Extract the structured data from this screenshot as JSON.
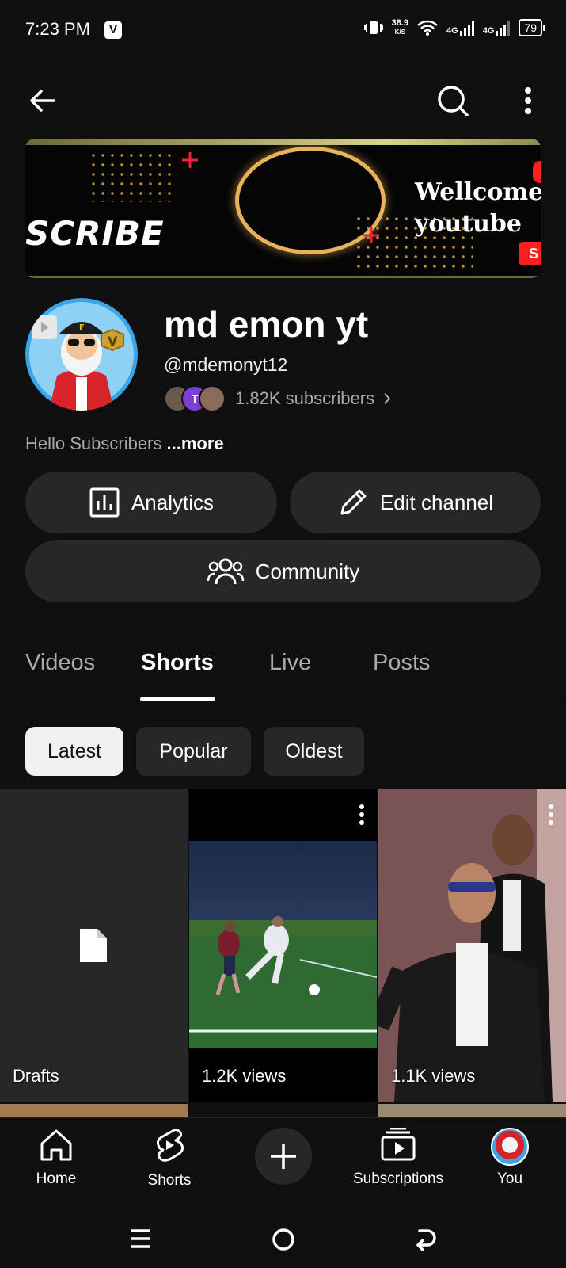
{
  "status_bar": {
    "time": "7:23 PM",
    "badge": "V",
    "net_speed_value": "38.9",
    "net_speed_unit": "K/S",
    "network_1": "4G",
    "network_2": "4G",
    "battery": "79"
  },
  "top_bar": {
    "back_icon": "arrow-left-icon",
    "search_icon": "search-icon",
    "more_icon": "more-vertical-icon"
  },
  "banner": {
    "text_left": "SCRIBE",
    "text_right_1": "Wellcome",
    "text_right_2": "youtube",
    "button_text": "S"
  },
  "channel": {
    "name": "md emon yt",
    "handle": "@mdemonyt12",
    "subscribers": "1.82K subscribers",
    "sub_avatar_letter": "T",
    "description": "Hello Subscribers",
    "more_label": "...more",
    "avatar_badge": "V",
    "avatar_cap": "F"
  },
  "actions": {
    "analytics": "Analytics",
    "edit_channel": "Edit channel",
    "community": "Community"
  },
  "tabs": [
    {
      "label": "Videos",
      "active": false
    },
    {
      "label": "Shorts",
      "active": true
    },
    {
      "label": "Live",
      "active": false
    },
    {
      "label": "Posts",
      "active": false
    }
  ],
  "chips": [
    {
      "label": "Latest",
      "active": true
    },
    {
      "label": "Popular",
      "active": false
    },
    {
      "label": "Oldest",
      "active": false
    }
  ],
  "shorts": [
    {
      "label": "Drafts",
      "icon": "file-icon"
    },
    {
      "label": "1.2K views"
    },
    {
      "label": "1.1K views"
    }
  ],
  "bottom_nav": [
    {
      "label": "Home",
      "icon": "home-icon"
    },
    {
      "label": "Shorts",
      "icon": "shorts-icon"
    },
    {
      "label": "",
      "icon": "plus-icon"
    },
    {
      "label": "Subscriptions",
      "icon": "subscriptions-icon"
    },
    {
      "label": "You",
      "icon": "avatar"
    }
  ],
  "colors": {
    "background": "#0f0f0f",
    "surface": "#272727",
    "text_secondary": "#aaaaaa"
  }
}
